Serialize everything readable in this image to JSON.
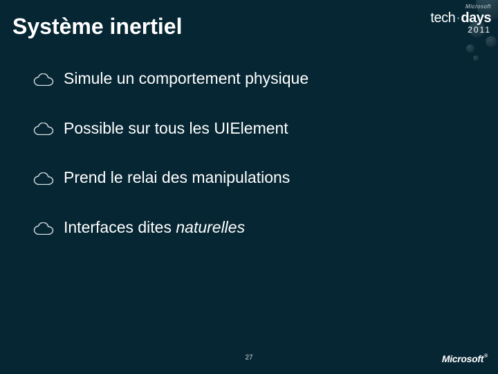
{
  "title": "Système inertiel",
  "bullets": [
    {
      "text": "Simule un comportement physique"
    },
    {
      "text": "Possible sur tous les UIElement"
    },
    {
      "text": "Prend le relai des manipulations"
    },
    {
      "prefix": "Interfaces dites ",
      "emph": "naturelles"
    }
  ],
  "slide_number": "27",
  "brand": {
    "microsoft_small": "Microsoft",
    "tech": "tech",
    "dot": "·",
    "days": "days",
    "year": "2011"
  },
  "footer_logo": "Microsoft"
}
